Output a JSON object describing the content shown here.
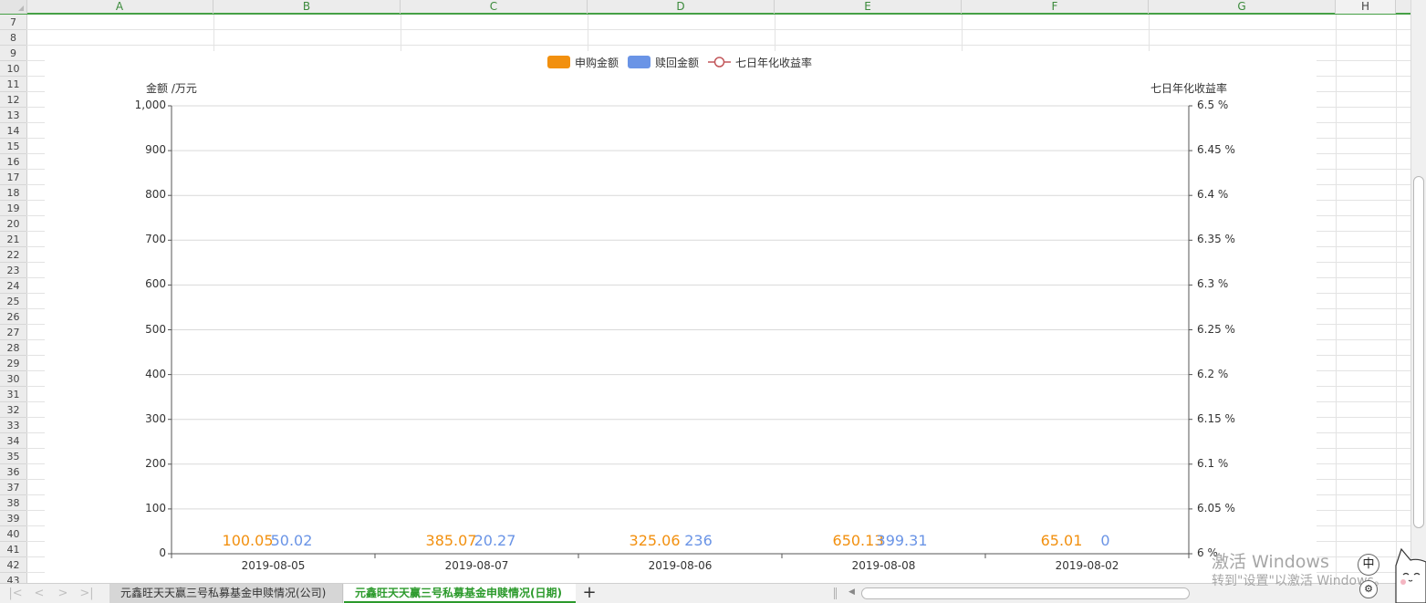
{
  "sheet": {
    "columns": [
      "A",
      "B",
      "C",
      "D",
      "E",
      "F",
      "G",
      "H"
    ],
    "rows": [
      "7",
      "8",
      "9",
      "10",
      "11",
      "12",
      "13",
      "14",
      "15",
      "16",
      "17",
      "18",
      "19",
      "20",
      "21",
      "22",
      "23",
      "24",
      "25",
      "26",
      "27",
      "28",
      "29",
      "30",
      "31",
      "32",
      "33",
      "34",
      "35",
      "36",
      "37",
      "38",
      "39",
      "40",
      "41",
      "42",
      "43"
    ]
  },
  "tabs": {
    "inactive_label": "元鑫旺天天赢三号私募基金申赎情况(公司)",
    "active_label": "元鑫旺天天赢三号私募基金申赎情况(日期)",
    "add_label": "+"
  },
  "nav": {
    "first": "|<",
    "prev": "<",
    "next": ">",
    "last": ">|"
  },
  "overlay": {
    "watermark_line1": "激活 Windows",
    "watermark_line2": "转到\"设置\"以激活 Windows。",
    "ime_label": "中",
    "ime_small_label": "⚙"
  },
  "colors": {
    "subscribe": "#f2900f",
    "redeem": "#6a94e6",
    "rate_line": "#c2575a",
    "green": "#2c9a2c"
  },
  "chart_data": {
    "type": "bar",
    "categories": [
      "2019-08-05",
      "2019-08-07",
      "2019-08-06",
      "2019-08-08",
      "2019-08-02"
    ],
    "series": [
      {
        "name": "申购金额",
        "type": "bar",
        "values": [
          100.05,
          385.07,
          325.06,
          650.13,
          65.01
        ],
        "labels": [
          "100.05",
          "385.07",
          "325.06",
          "650.13",
          "65.01"
        ]
      },
      {
        "name": "赎回金额",
        "type": "bar",
        "values": [
          50.02,
          20.27,
          236,
          399.31,
          0
        ],
        "labels": [
          "50.02",
          "20.27",
          "236",
          "399.31",
          "0"
        ]
      },
      {
        "name": "七日年化收益率",
        "type": "line",
        "values": []
      }
    ],
    "ylabel_left": "金额 /万元",
    "ylabel_right": "七日年化收益率",
    "ylim_left": [
      0,
      1000
    ],
    "ylim_right": [
      6,
      6.5
    ],
    "left_ticks": [
      "0",
      "100",
      "200",
      "300",
      "400",
      "500",
      "600",
      "700",
      "800",
      "900",
      "1,000"
    ],
    "right_ticks": [
      "6 %",
      "6.05 %",
      "6.1 %",
      "6.15 %",
      "6.2 %",
      "6.25 %",
      "6.3 %",
      "6.35 %",
      "6.4 %",
      "6.45 %",
      "6.5 %"
    ],
    "legend_position": "top-center",
    "grid": true,
    "bars_rendered": false
  }
}
